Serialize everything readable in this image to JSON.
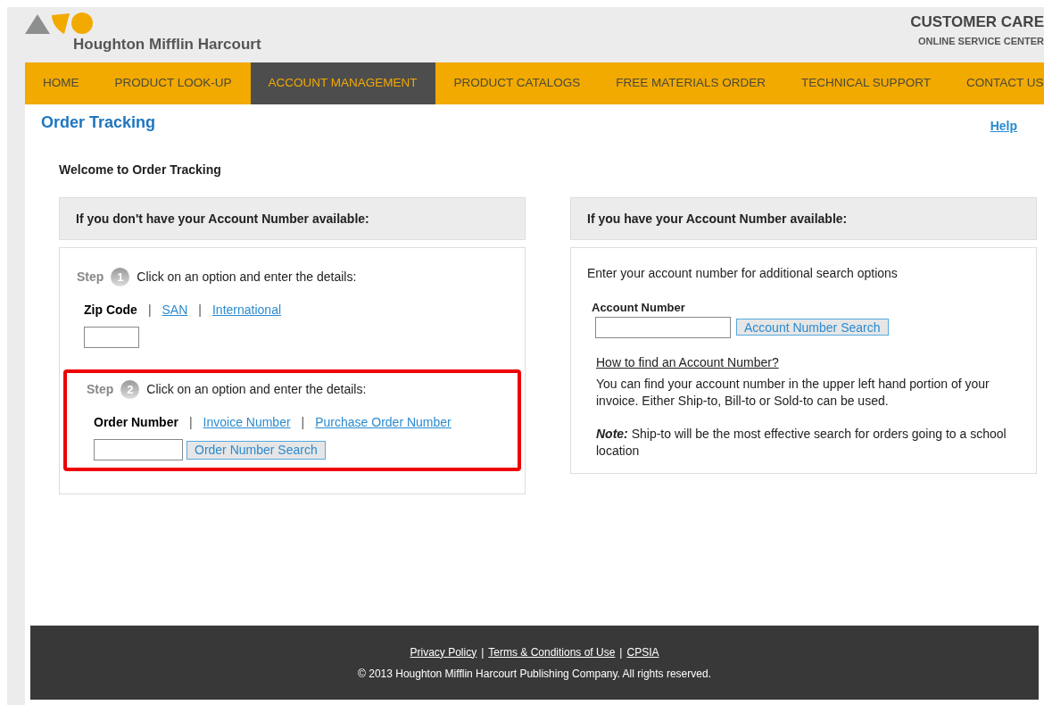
{
  "header": {
    "brand": "Houghton Mifflin Harcourt",
    "title": "CUSTOMER CARE",
    "subtitle": "ONLINE SERVICE CENTER"
  },
  "nav": [
    {
      "label": "HOME",
      "selected": false
    },
    {
      "label": "PRODUCT LOOK-UP",
      "selected": false
    },
    {
      "label": "ACCOUNT MANAGEMENT",
      "selected": true
    },
    {
      "label": "PRODUCT CATALOGS",
      "selected": false
    },
    {
      "label": "FREE MATERIALS ORDER",
      "selected": false
    },
    {
      "label": "TECHNICAL SUPPORT",
      "selected": false
    },
    {
      "label": "CONTACT US",
      "selected": false
    }
  ],
  "page": {
    "title": "Order Tracking",
    "help": "Help",
    "welcome": "Welcome to Order Tracking"
  },
  "left_panel": {
    "heading": "If you don't have your Account Number available:",
    "separator": "|",
    "steps": [
      {
        "step_label": "Step",
        "number": "1",
        "instruction": "Click on an option and enter the details:",
        "options": [
          {
            "label": "Zip Code",
            "selected": true
          },
          {
            "label": "SAN",
            "selected": false
          },
          {
            "label": "International",
            "selected": false
          }
        ]
      },
      {
        "step_label": "Step",
        "number": "2",
        "instruction": "Click on an option and enter the details:",
        "highlighted": true,
        "options": [
          {
            "label": "Order Number",
            "selected": true
          },
          {
            "label": "Invoice Number",
            "selected": false
          },
          {
            "label": "Purchase Order Number",
            "selected": false
          }
        ],
        "button": "Order Number Search"
      }
    ]
  },
  "right_panel": {
    "heading": "If you have your Account Number available:",
    "intro": "Enter your account number for additional search options",
    "field_label": "Account Number",
    "button": "Account Number Search",
    "help_link": "How to find an Account Number?",
    "help_text": "You can find your account number in the upper left hand portion of your invoice. Either Ship-to, Bill-to or Sold-to can be used.",
    "note": "**Note:** Ship-to will be the most effective search for orders going to a school location"
  },
  "footer": {
    "separator": "|",
    "links": [
      "Privacy Policy",
      "Terms & Conditions of Use",
      "CPSIA"
    ],
    "copyright": "© 2013 Houghton Mifflin Harcourt Publishing Company. All rights reserved."
  }
}
